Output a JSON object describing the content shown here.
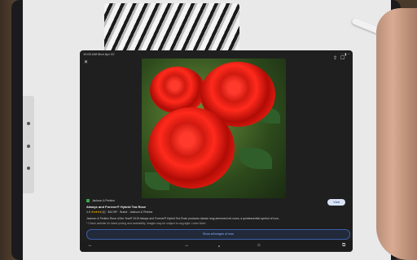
{
  "status_bar": {
    "time": "10:00 AM",
    "date": "Mon Apr 22",
    "indicators": "⋯ ▮ ◔"
  },
  "top_bar": {
    "close_icon": "close-icon",
    "share_icon": "share-icon",
    "bookmark_icon": "bookmark-icon",
    "menu_icon": "more-vert-icon"
  },
  "result": {
    "source": "Jackson & Perkins",
    "title": "Always and Forever® Hybrid Tea Rose",
    "rating": "4.6",
    "stars": "★★★★★",
    "reviews": "(4)",
    "price": "$44.95*",
    "extra": "Brand · Jackson & Perkins",
    "visit_label": "Visit",
    "description": "Jackson & Perkins Rose of the Year® 2019 Always and Forever® Hybrid Tea Rose produces classic long-stemmed red roses, a quintessential symbol of love...",
    "notice": "* Check website for latest pricing and availability. Images may be subject to copyright. Learn More"
  },
  "show_all_label": "Show all images of rose",
  "bottom_nav": {
    "back": "←",
    "forward": "→",
    "home": "⌂",
    "tabs": "⧉"
  },
  "colors": {
    "rose_red": "#d11a10",
    "link_blue": "#8fb2ff",
    "star_gold": "#f2b400"
  }
}
